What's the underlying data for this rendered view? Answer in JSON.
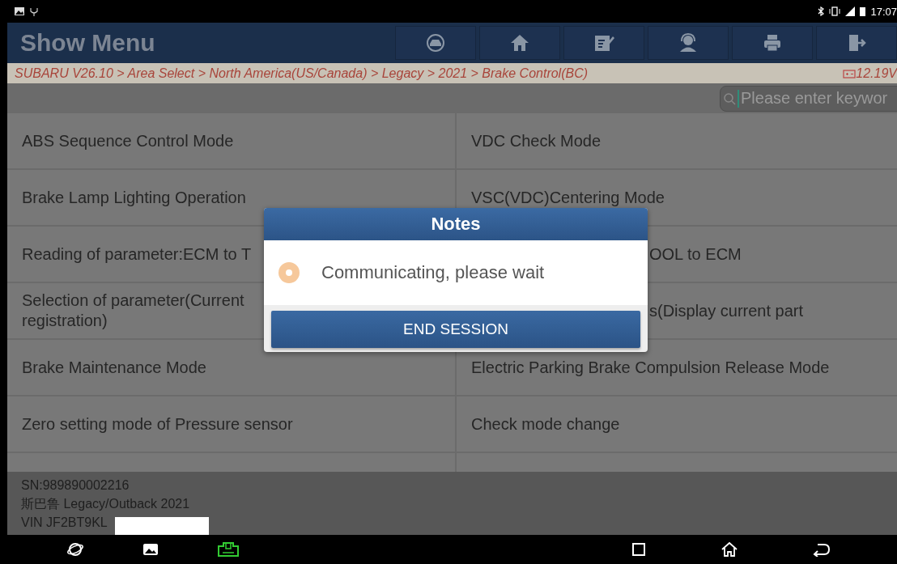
{
  "status_bar": {
    "time": "17:07"
  },
  "header": {
    "title": "Show Menu"
  },
  "breadcrumb": {
    "path": "SUBARU V26.10 > Area Select > North America(US/Canada) > Legacy > 2021 > Brake Control(BC)",
    "voltage": "12.19V"
  },
  "search": {
    "placeholder": "Please enter keywor"
  },
  "menu_items": [
    {
      "label": "ABS Sequence Control Mode"
    },
    {
      "label": "VDC Check Mode"
    },
    {
      "label": "Brake Lamp Lighting Operation"
    },
    {
      "label": "VSC(VDC)Centering Mode"
    },
    {
      "label": "Reading of parameter:ECM to T"
    },
    {
      "label": "OOL to ECM"
    },
    {
      "label": "Selection of parameter(Current\nregistration)"
    },
    {
      "label": "s(Display current part"
    },
    {
      "label": "Brake Maintenance Mode"
    },
    {
      "label": "Electric Parking Brake Compulsion Release Mode"
    },
    {
      "label": "Zero setting mode of Pressure sensor"
    },
    {
      "label": "Check mode change"
    }
  ],
  "footer": {
    "lines": [
      "SN:989890002216",
      "斯巴鲁 Legacy/Outback 2021",
      "VIN JF2BT9KL"
    ]
  },
  "dialog": {
    "title": "Notes",
    "message": "Communicating, please wait",
    "button": "END SESSION"
  }
}
